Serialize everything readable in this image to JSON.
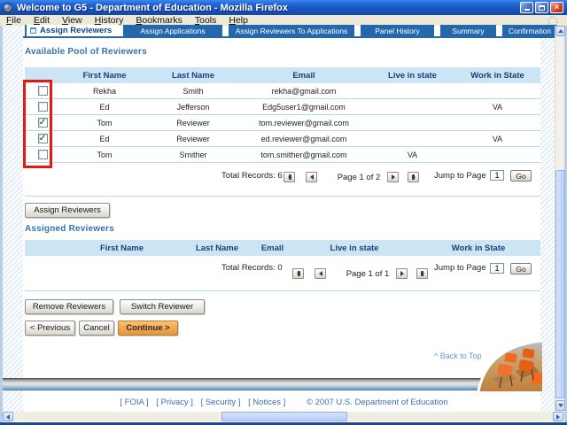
{
  "window": {
    "title": "Welcome to G5 - Department of Education - Mozilla Firefox"
  },
  "menu": {
    "items": [
      "File",
      "Edit",
      "View",
      "History",
      "Bookmarks",
      "Tools",
      "Help"
    ]
  },
  "tabs": [
    {
      "label": "Assign Reviewers",
      "active": true
    },
    {
      "label": "Assign Applications",
      "active": false
    },
    {
      "label": "Assign Reviewers To Applications",
      "active": false
    },
    {
      "label": "Panel History",
      "active": false
    },
    {
      "label": "Summary",
      "active": false
    },
    {
      "label": "Confirmation",
      "active": false
    }
  ],
  "pool": {
    "heading": "Available Pool of Reviewers",
    "columns": [
      "",
      "First Name",
      "Last Name",
      "Email",
      "Live in state",
      "Work in State"
    ],
    "rows": [
      {
        "checked": false,
        "first_name": "Rekha",
        "last_name": "Smith",
        "email": "rekha@gmail.com",
        "live_in_state": "",
        "work_in_state": ""
      },
      {
        "checked": false,
        "first_name": "Ed",
        "last_name": "Jefferson",
        "email": "Edg5user1@gmail.com",
        "live_in_state": "",
        "work_in_state": "VA"
      },
      {
        "checked": true,
        "first_name": "Tom",
        "last_name": "Reviewer",
        "email": "tom.reviewer@gmail.com",
        "live_in_state": "",
        "work_in_state": ""
      },
      {
        "checked": true,
        "first_name": "Ed",
        "last_name": "Reviewer",
        "email": "ed.reviewer@gmail.com",
        "live_in_state": "",
        "work_in_state": "VA"
      },
      {
        "checked": false,
        "first_name": "Tom",
        "last_name": "Smither",
        "email": "tom.smither@gmail.com",
        "live_in_state": "VA",
        "work_in_state": ""
      }
    ],
    "pagination": {
      "total": "Total Records: 6",
      "page": "Page 1 of 2",
      "jump_label": "Jump to Page",
      "jump_value": "1",
      "go": "Go"
    }
  },
  "assign_button": "Assign Reviewers",
  "assigned": {
    "heading": "Assigned Reviewers",
    "columns": [
      "",
      "First Name",
      "Last Name",
      "Email",
      "Live in state",
      "Work in State"
    ],
    "rows": [],
    "pagination": {
      "total": "Total Records: 0",
      "page": "Page 1 of 1",
      "jump_label": "Jump to Page",
      "jump_value": "1",
      "go": "Go"
    }
  },
  "actions": {
    "remove": "Remove Reviewers",
    "switch": "Switch Reviewer",
    "previous": "< Previous",
    "cancel": "Cancel",
    "continue": "Continue >"
  },
  "back_to_top": "^ Back to Top",
  "footer": {
    "links": [
      "[ FOIA ]",
      "[ Privacy ]",
      "[ Security ]",
      "[ Notices ]"
    ],
    "copyright": "©  2007  U.S.  Department  of  Education"
  },
  "icons": {
    "firefox": "firefox-globe-icon",
    "throbber": "gear-throbber-icon",
    "pager_first": "bar-with-left-triangle",
    "pager_prev": "left-triangle",
    "pager_next": "right-triangle",
    "pager_last": "right-triangle-with-bar",
    "checkbox_check": "green-check"
  },
  "colors": {
    "tab_blue": "#2368ad",
    "table_header_band": "#cce5f5",
    "heading_blue": "#3473ae",
    "continue_orange": "#f2a44c",
    "annotation_red": "#e11b12",
    "titlebar_blue": "#1a55be"
  }
}
